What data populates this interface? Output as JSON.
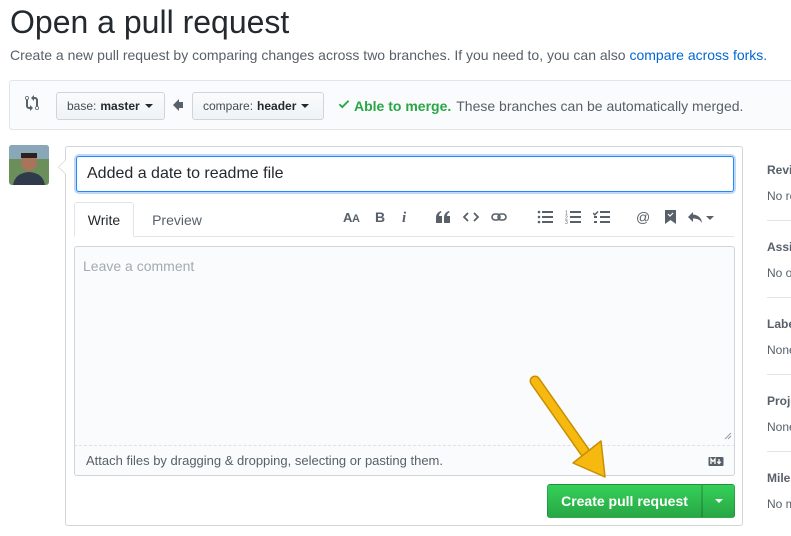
{
  "page": {
    "title": "Open a pull request",
    "subtitle": "Create a new pull request by comparing changes across two branches. If you need to, you can also ",
    "subtitle_link": "compare across forks."
  },
  "range": {
    "base_label": "base:",
    "base_value": "master",
    "compare_label": "compare:",
    "compare_value": "header",
    "merge_status": "Able to merge.",
    "merge_message": "These branches can be automatically merged."
  },
  "form": {
    "title_value": "Added a date to readme file",
    "tabs": [
      {
        "label": "Write"
      },
      {
        "label": "Preview"
      }
    ],
    "toolbar": [
      "header-icon",
      "bold-icon",
      "italic-icon",
      "quote-icon",
      "code-icon",
      "link-icon",
      "bulleted-list-icon",
      "numbered-list-icon",
      "task-list-icon",
      "mention-icon",
      "reference-icon",
      "reply-icon"
    ],
    "comment_placeholder": "Leave a comment",
    "attach_text": "Attach files by dragging & dropping, selecting or pasting them.",
    "submit_label": "Create pull request"
  },
  "sidebar": {
    "sections": [
      {
        "head": "Reviewers",
        "body": "No reviews"
      },
      {
        "head": "Assignees",
        "body": "No one assigned"
      },
      {
        "head": "Labels",
        "body": "None yet"
      },
      {
        "head": "Projects",
        "body": "None yet"
      },
      {
        "head": "Milestone",
        "body": "No milestone"
      }
    ]
  },
  "colors": {
    "link": "#0366d6",
    "success": "#28a745",
    "focus": "#2188ff",
    "annotation": "#f5b90f"
  }
}
